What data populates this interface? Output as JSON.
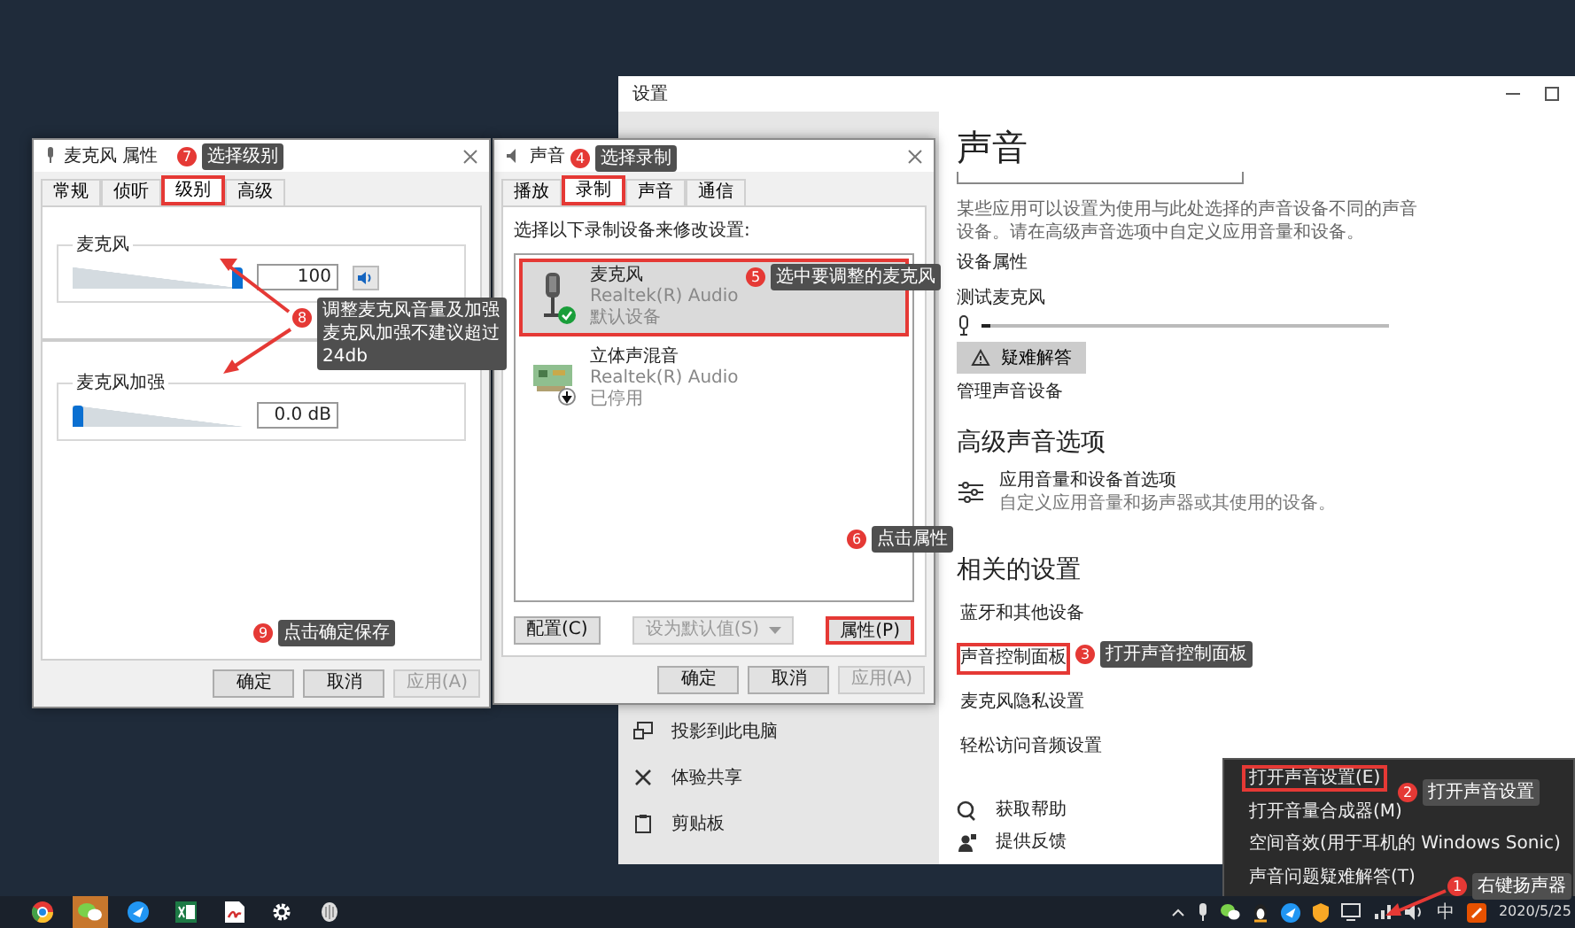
{
  "settings_window": {
    "title": "设置",
    "heading": "声音",
    "description": "某些应用可以设置为使用与此处选择的声音设备不同的声音设备。请在高级声音选项中自定义应用音量和设备。",
    "device_properties_link": "设备属性",
    "test_mic_label": "测试麦克风",
    "mic_meter": {
      "level": 0.02
    },
    "troubleshoot_button": "疑难解答",
    "manage_devices_link": "管理声音设备",
    "advanced_heading": "高级声音选项",
    "app_volume": {
      "title": "应用音量和设备首选项",
      "subtitle": "自定义应用音量和扬声器或其使用的设备。"
    },
    "related_heading": "相关的设置",
    "related_links": [
      {
        "label": "蓝牙和其他设备",
        "marked": false
      },
      {
        "label": "声音控制面板",
        "marked": true
      },
      {
        "label": "麦克风隐私设置",
        "marked": false
      },
      {
        "label": "轻松访问音频设置",
        "marked": false
      }
    ],
    "help_links": [
      {
        "label": "获取帮助",
        "kind": "help"
      },
      {
        "label": "提供反馈",
        "kind": "feedback"
      }
    ],
    "sidebar_items": [
      {
        "label": "投影到此电脑",
        "kind": "project"
      },
      {
        "label": "体验共享",
        "kind": "share"
      },
      {
        "label": "剪贴板",
        "kind": "clipboard"
      }
    ]
  },
  "sound_dialog": {
    "title": "声音",
    "tabs": [
      {
        "label": "播放",
        "selected": false,
        "marked": false
      },
      {
        "label": "录制",
        "selected": true,
        "marked": true
      },
      {
        "label": "声音",
        "selected": false,
        "marked": false
      },
      {
        "label": "通信",
        "selected": false,
        "marked": false
      }
    ],
    "instruction": "选择以下录制设备来修改设置:",
    "devices": [
      {
        "name": "麦克风",
        "driver": "Realtek(R) Audio",
        "status": "默认设备",
        "kind": "microphone",
        "badge": {
          "kind": "check"
        },
        "selected": true,
        "marked": true
      },
      {
        "name": "立体声混音",
        "driver": "Realtek(R) Audio",
        "status": "已停用",
        "kind": "mixer",
        "badge": {
          "kind": "arrow"
        },
        "selected": false,
        "marked": false
      }
    ],
    "buttons": [
      {
        "label": "配置(C)",
        "kind": "plain",
        "disabled": false,
        "marked": false
      },
      {
        "label": "设为默认值(S)",
        "kind": "split",
        "disabled": true,
        "marked": false
      },
      {
        "label": "属性(P)",
        "kind": "plain",
        "disabled": false,
        "marked": true
      }
    ],
    "footer_buttons": [
      {
        "label": "确定",
        "disabled": false
      },
      {
        "label": "取消",
        "disabled": false
      },
      {
        "label": "应用(A)",
        "disabled": true
      }
    ]
  },
  "mic_dialog": {
    "title": "麦克风 属性",
    "tabs": [
      {
        "label": "常规",
        "selected": false,
        "marked": false
      },
      {
        "label": "侦听",
        "selected": false,
        "marked": false
      },
      {
        "label": "级别",
        "selected": true,
        "marked": true
      },
      {
        "label": "高级",
        "selected": false,
        "marked": false
      }
    ],
    "groups": [
      {
        "label": "麦克风",
        "kind": "volume",
        "level": 1,
        "value": "100"
      },
      {
        "label": "麦克风加强",
        "kind": "boost",
        "level": 0,
        "value": "0.0 dB"
      }
    ],
    "footer_buttons": [
      {
        "label": "确定",
        "disabled": false
      },
      {
        "label": "取消",
        "disabled": false
      },
      {
        "label": "应用(A)",
        "disabled": true
      }
    ]
  },
  "context_menu": {
    "items": [
      {
        "label": "打开声音设置(E)",
        "marked": true
      },
      {
        "label": "打开音量合成器(M)",
        "marked": false
      },
      {
        "label": "空间音效(用于耳机的 Windows Sonic)",
        "marked": false
      },
      {
        "label": "声音问题疑难解答(T)",
        "marked": false
      }
    ]
  },
  "annotations": [
    {
      "number": "7",
      "text": "选择级别"
    },
    {
      "number": "4",
      "text": "选择录制"
    },
    {
      "number": "5",
      "text": "选中要调整的麦克风"
    },
    {
      "number": "8",
      "text": "调整麦克风音量及加强麦克风加强不建议超过24db"
    },
    {
      "number": "6",
      "text": "点击属性"
    },
    {
      "number": "9",
      "text": "点击确定保存"
    },
    {
      "number": "3",
      "text": "打开声音控制面板"
    },
    {
      "number": "2",
      "text": "打开声音设置"
    },
    {
      "number": "1",
      "text": "右键扬声器"
    }
  ],
  "taskbar": {
    "pinned": [
      {
        "kind": "browser",
        "active": false
      },
      {
        "kind": "chat",
        "active": true
      },
      {
        "kind": "bird",
        "active": false
      },
      {
        "kind": "sheet",
        "active": false
      },
      {
        "kind": "pdf",
        "active": false
      },
      {
        "kind": "gear",
        "active": false
      },
      {
        "kind": "shell",
        "active": false
      }
    ],
    "ime": "中",
    "date": "2020/5/25"
  }
}
